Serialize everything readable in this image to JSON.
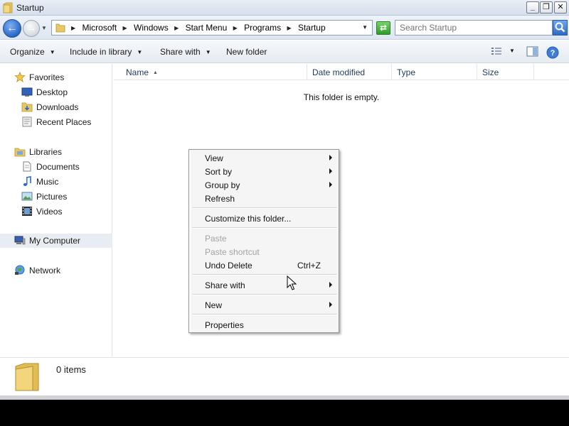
{
  "window": {
    "title": "Startup",
    "controls": {
      "minimize": "_",
      "maximize": "❐",
      "close": "✕"
    }
  },
  "address": {
    "breadcrumbs": [
      "Microsoft",
      "Windows",
      "Start Menu",
      "Programs",
      "Startup"
    ],
    "search_placeholder": "Search Startup"
  },
  "toolbar": {
    "organize": "Organize",
    "include_in_library": "Include in library",
    "share_with": "Share with",
    "new_folder": "New folder"
  },
  "sidebar": {
    "favorites": {
      "label": "Favorites",
      "items": [
        "Desktop",
        "Downloads",
        "Recent Places"
      ]
    },
    "libraries": {
      "label": "Libraries",
      "items": [
        "Documents",
        "Music",
        "Pictures",
        "Videos"
      ]
    },
    "computer": "My Computer",
    "network": "Network"
  },
  "columns": [
    "Name",
    "Date modified",
    "Type",
    "Size"
  ],
  "content": {
    "empty_message": "This folder is empty."
  },
  "status": {
    "item_count": "0 items"
  },
  "context_menu": {
    "view": "View",
    "sort_by": "Sort by",
    "group_by": "Group by",
    "refresh": "Refresh",
    "customize": "Customize this folder...",
    "paste": "Paste",
    "paste_shortcut": "Paste shortcut",
    "undo_delete": "Undo Delete",
    "undo_shortcut": "Ctrl+Z",
    "share_with": "Share with",
    "new": "New",
    "properties": "Properties"
  },
  "colors": {
    "accent": "#2a68c9",
    "menu_disabled": "#a3a3a3",
    "selected_nav": "#e8edf3"
  }
}
